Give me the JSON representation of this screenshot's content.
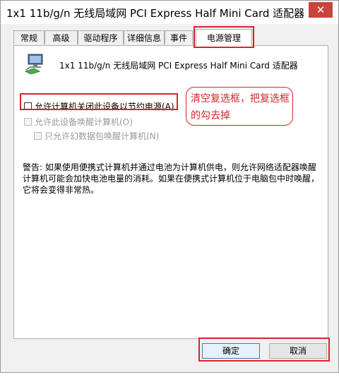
{
  "window": {
    "title": "1x1 11b/g/n 无线局域网 PCI Express Half Mini Card 适配器",
    "close_glyph": "✕"
  },
  "tabs": [
    {
      "label": "常规",
      "active": false
    },
    {
      "label": "高级",
      "active": false
    },
    {
      "label": "驱动程序",
      "active": false
    },
    {
      "label": "详细信息",
      "active": false
    },
    {
      "label": "事件",
      "active": false
    },
    {
      "label": "电源管理",
      "active": true
    }
  ],
  "device": {
    "icon": "network-adapter-icon",
    "name": "1x1 11b/g/n 无线局域网 PCI Express Half Mini Card 适配器"
  },
  "options": {
    "allow_turn_off": {
      "label": "允许计算机关闭此设备以节约电源(A)",
      "checked": false,
      "enabled": true
    },
    "allow_wake": {
      "label": "允许此设备唤醒计算机(O)",
      "checked": false,
      "enabled": false
    },
    "magic_packet_only": {
      "label": "只允许幻数据包唤醒计算机(N)",
      "checked": false,
      "enabled": false
    }
  },
  "warning_text": "警告: 如果使用便携式计算机并通过电池为计算机供电，则允许网络适配器唤醒计算机可能会加快电池电量的消耗。如果在便携式计算机位于电脑包中时唤醒，它将会变得非常热。",
  "annotation": {
    "callout_text": "清空复选框，把复选框的勾去掉",
    "color": "#d8232a"
  },
  "buttons": {
    "ok": "确定",
    "cancel": "取消"
  }
}
